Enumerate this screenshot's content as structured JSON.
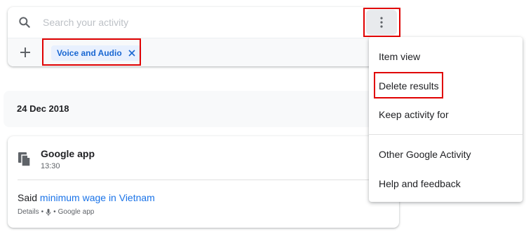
{
  "search": {
    "placeholder": "Search your activity"
  },
  "filters": {
    "chips": [
      {
        "label": "Voice and Audio"
      }
    ]
  },
  "menu": {
    "items": [
      {
        "label": "Item view"
      },
      {
        "label": "Delete results"
      },
      {
        "label": "Keep activity for"
      },
      {
        "label": "Other Google Activity"
      },
      {
        "label": "Help and feedback"
      }
    ]
  },
  "date_group": {
    "label": "24 Dec 2018"
  },
  "activity": {
    "product": "Google app",
    "time": "13:30",
    "said_prefix": "Said",
    "query": "minimum wage in Vietnam",
    "details_label": "Details",
    "separator": "•",
    "source": "Google app"
  },
  "colors": {
    "accent": "#1a73e8",
    "chip_bg": "#e8f0fe",
    "highlight": "#e00000"
  }
}
